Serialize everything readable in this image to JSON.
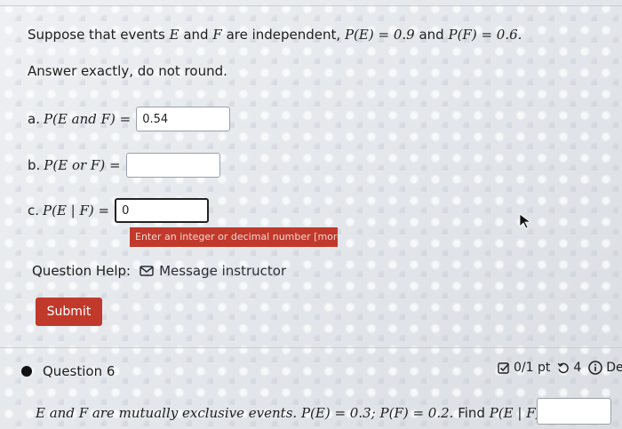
{
  "problem": {
    "prefix": "Suppose that events",
    "e": "E",
    "and": "and",
    "f": "F",
    "suffix": "are independent,",
    "pe_expr": "P(E) = 0.9",
    "and2": "and",
    "pf_expr": "P(F) = 0.6."
  },
  "instruction": "Answer exactly, do not round.",
  "parts": [
    {
      "label": "a.",
      "expr": "P(E and F) =",
      "value": "0.54"
    },
    {
      "label": "b.",
      "expr": "P(E or F) =",
      "value": ""
    },
    {
      "label": "c.",
      "expr": "P(E | F) =",
      "value": "0"
    }
  ],
  "tooltip": "Enter an integer or decimal number [more..]",
  "help": {
    "label": "Question Help:",
    "message_label": "Message instructor"
  },
  "submit_label": "Submit",
  "question6": {
    "title": "Question 6",
    "score": "0/1 pt",
    "attempts": "4",
    "details_label": "De",
    "text_prefix": "E and F are mutually exclusive events.",
    "expr": "P(E) = 0.3; P(F) = 0.2.",
    "find": "Find",
    "find_expr": "P(E | F)."
  }
}
